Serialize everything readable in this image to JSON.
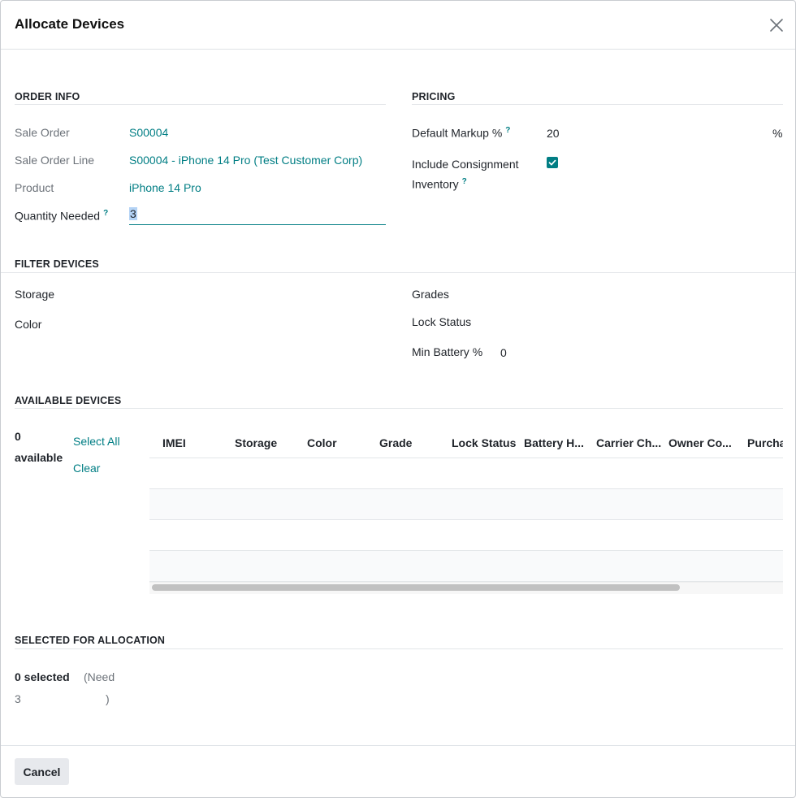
{
  "dialog": {
    "title": "Allocate Devices"
  },
  "order_info": {
    "section_title": "ORDER INFO",
    "sale_order_label": "Sale Order",
    "sale_order_value": "S00004",
    "sale_order_line_label": "Sale Order Line",
    "sale_order_line_value": "S00004 - iPhone 14 Pro (Test Customer Corp)",
    "product_label": "Product",
    "product_value": "iPhone 14 Pro",
    "quantity_label": "Quantity Needed",
    "quantity_value": "3",
    "help_mark": "?"
  },
  "pricing": {
    "section_title": "PRICING",
    "markup_label": "Default Markup %",
    "markup_value": "20",
    "markup_unit": "%",
    "consignment_label_line1": "Include Consignment",
    "consignment_label_line2": "Inventory",
    "consignment_checked": true
  },
  "filter": {
    "section_title": "FILTER DEVICES",
    "storage_label": "Storage",
    "color_label": "Color",
    "grades_label": "Grades",
    "lock_status_label": "Lock Status",
    "min_battery_label": "Min Battery %",
    "min_battery_value": "0"
  },
  "available": {
    "section_title": "AVAILABLE DEVICES",
    "count": "0",
    "count_label": "available",
    "select_all": "Select All",
    "clear": "Clear",
    "columns": [
      "IMEI",
      "Storage",
      "Color",
      "Grade",
      "Lock Status",
      "Battery H...",
      "Carrier Ch...",
      "Owner Co...",
      "Purcha"
    ]
  },
  "selected": {
    "section_title": "SELECTED FOR ALLOCATION",
    "count_text": "0 selected",
    "need_open": "(Need",
    "need_value": "3",
    "need_close": ")"
  },
  "footer": {
    "cancel_label": "Cancel"
  },
  "colors": {
    "accent": "#017e84",
    "text": "#1f2329",
    "muted": "#6c7279"
  }
}
